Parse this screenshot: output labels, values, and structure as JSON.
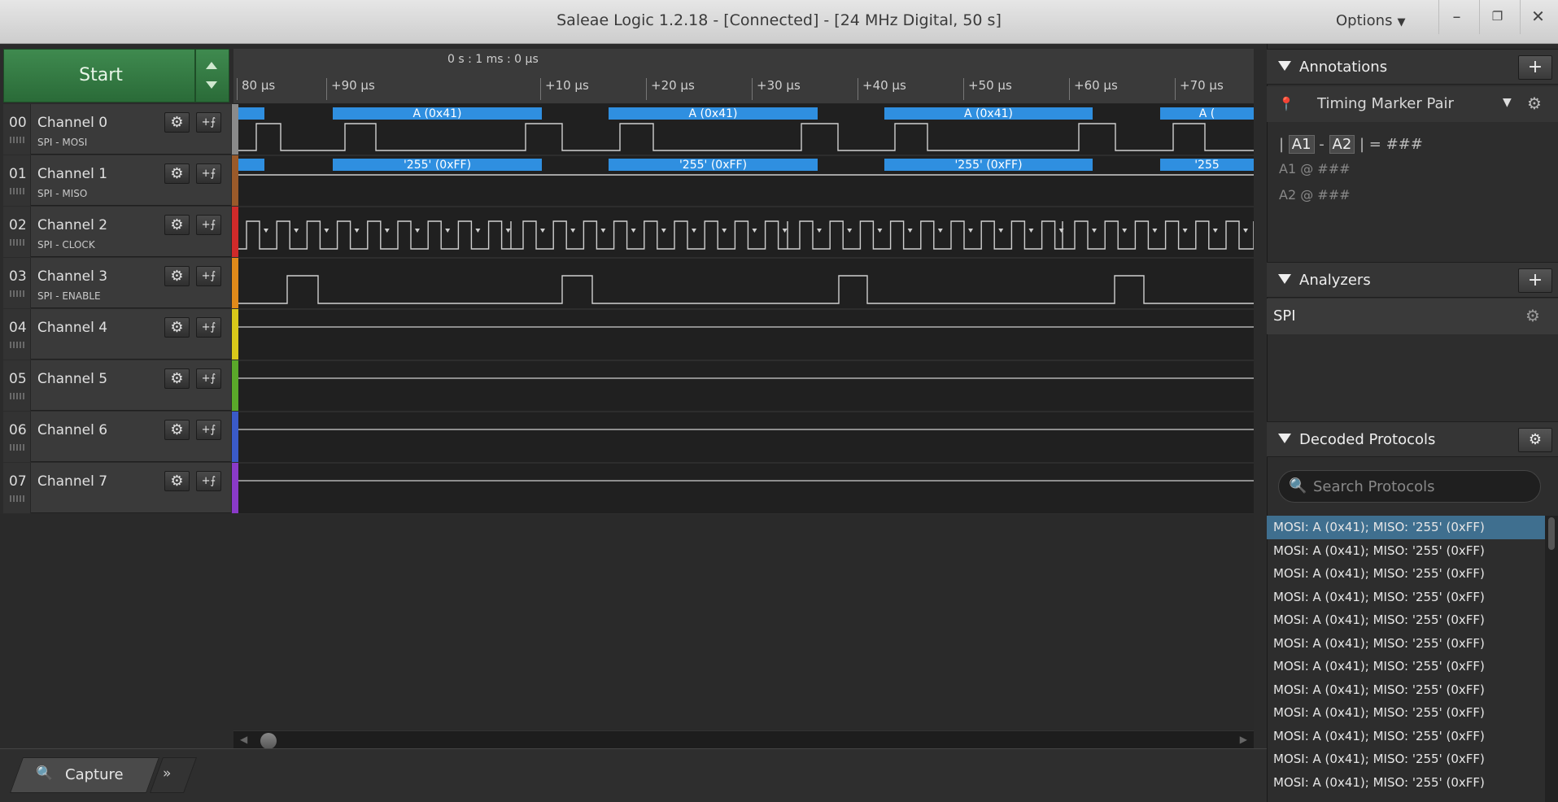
{
  "window": {
    "title": "Saleae Logic 1.2.18 - [Connected] - [24 MHz Digital, 50 s]",
    "options_label": "Options"
  },
  "start": {
    "label": "Start"
  },
  "channels": [
    {
      "index": "00",
      "name": "Channel 0",
      "sub": "SPI - MOSI",
      "color": "#8a8a8a"
    },
    {
      "index": "01",
      "name": "Channel 1",
      "sub": "SPI - MISO",
      "color": "#9a5a2a"
    },
    {
      "index": "02",
      "name": "Channel 2",
      "sub": "SPI - CLOCK",
      "color": "#d02a2a"
    },
    {
      "index": "03",
      "name": "Channel 3",
      "sub": "SPI - ENABLE",
      "color": "#e08a1a"
    },
    {
      "index": "04",
      "name": "Channel 4",
      "sub": "",
      "color": "#d8c81a"
    },
    {
      "index": "05",
      "name": "Channel 5",
      "sub": "",
      "color": "#5aa82a"
    },
    {
      "index": "06",
      "name": "Channel 6",
      "sub": "",
      "color": "#3a5ac8"
    },
    {
      "index": "07",
      "name": "Channel 7",
      "sub": "",
      "color": "#8a3ac8"
    }
  ],
  "ruler": {
    "center": "0 s : 1 ms : 0 μs",
    "ticks": [
      "80 μs",
      "+90 μs",
      "+10 μs",
      "+20 μs",
      "+30 μs",
      "+40 μs",
      "+50 μs",
      "+60 μs",
      "+70 μs"
    ]
  },
  "decode": {
    "mosi_label": "A (0x41)",
    "miso_label": "'255' (0xFF)",
    "mosi_partial": "A (",
    "miso_partial": "'255",
    "bar_color": "#2f8fe0"
  },
  "capture_tab": {
    "label": "Capture"
  },
  "annotations": {
    "title": "Annotations",
    "timing_marker": "Timing Marker Pair",
    "formula": {
      "a1": "A1",
      "a2": "A2",
      "result": "= ###"
    },
    "a1_line": "A1 @ ###",
    "a2_line": "A2 @ ###"
  },
  "analyzers": {
    "title": "Analyzers",
    "items": [
      {
        "label": "SPI"
      }
    ]
  },
  "decoded": {
    "title": "Decoded Protocols",
    "search_placeholder": "Search Protocols",
    "items": [
      "MOSI: A (0x41);  MISO: '255' (0xFF)",
      "MOSI: A (0x41);  MISO: '255' (0xFF)",
      "MOSI: A (0x41);  MISO: '255' (0xFF)",
      "MOSI: A (0x41);  MISO: '255' (0xFF)",
      "MOSI: A (0x41);  MISO: '255' (0xFF)",
      "MOSI: A (0x41);  MISO: '255' (0xFF)",
      "MOSI: A (0x41);  MISO: '255' (0xFF)",
      "MOSI: A (0x41);  MISO: '255' (0xFF)",
      "MOSI: A (0x41);  MISO: '255' (0xFF)",
      "MOSI: A (0x41);  MISO: '255' (0xFF)",
      "MOSI: A (0x41);  MISO: '255' (0xFF)",
      "MOSI: A (0x41);  MISO: '255' (0xFF)"
    ]
  }
}
